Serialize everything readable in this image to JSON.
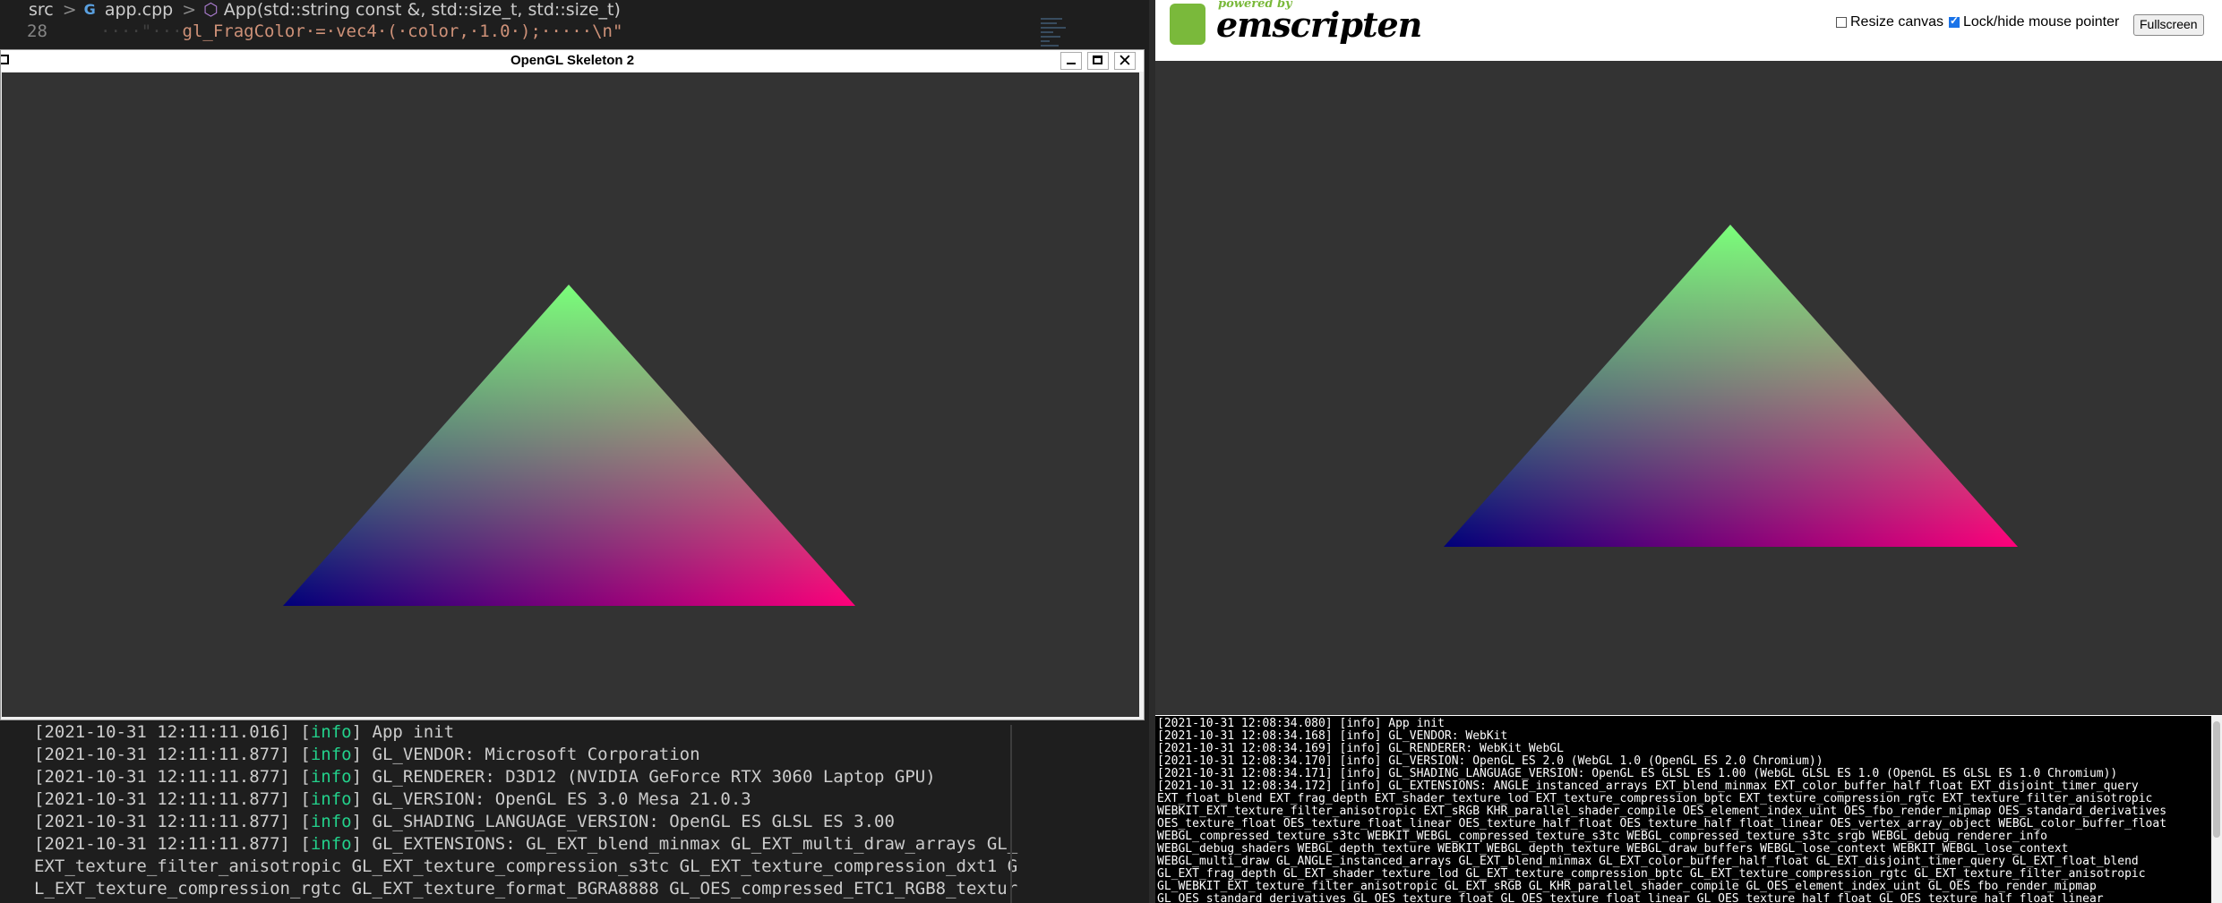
{
  "editor": {
    "breadcrumb": {
      "folder": "src",
      "file": "app.cpp",
      "symbol": "App(std::string const &, std::size_t, std::size_t)"
    },
    "line_number": "28",
    "code_ws_prefix": "····\"···",
    "code": "gl_FragColor·=·vec4·(·color,·1.0·);·····\\n\""
  },
  "terminal": {
    "lines": [
      {
        "prefix": "[2021-10-31 12:11:11.016] [",
        "level": "info",
        "text": "] App init"
      },
      {
        "prefix": "[2021-10-31 12:11:11.877] [",
        "level": "info",
        "text": "] GL_VENDOR: Microsoft Corporation"
      },
      {
        "prefix": "[2021-10-31 12:11:11.877] [",
        "level": "info",
        "text": "] GL_RENDERER: D3D12 (NVIDIA GeForce RTX 3060 Laptop GPU)"
      },
      {
        "prefix": "[2021-10-31 12:11:11.877] [",
        "level": "info",
        "text": "] GL_VERSION: OpenGL ES 3.0 Mesa 21.0.3"
      },
      {
        "prefix": "[2021-10-31 12:11:11.877] [",
        "level": "info",
        "text": "] GL_SHADING_LANGUAGE_VERSION: OpenGL ES GLSL ES 3.00"
      },
      {
        "prefix": "[2021-10-31 12:11:11.877] [",
        "level": "info",
        "text": "] GL_EXTENSIONS: GL_EXT_blend_minmax GL_EXT_multi_draw_arrays GL_"
      },
      {
        "prefix": "",
        "level": "",
        "text": "EXT_texture_filter_anisotropic GL_EXT_texture_compression_s3tc GL_EXT_texture_compression_dxt1 G"
      },
      {
        "prefix": "",
        "level": "",
        "text": "L_EXT_texture_compression_rgtc GL_EXT_texture_format_BGRA8888 GL_OES_compressed_ETC1_RGB8_textur"
      }
    ]
  },
  "gl_window": {
    "title": "OpenGL Skeleton 2",
    "close_glyph": "✕"
  },
  "emscripten": {
    "powered_by": "powered by",
    "logo_text": "emscripten",
    "resize_label": "Resize canvas",
    "resize_checked": false,
    "lock_label": "Lock/hide mouse pointer",
    "lock_checked": true,
    "fullscreen_label": "Fullscreen",
    "console_lines": [
      "[2021-10-31 12:08:34.080] [info] App init",
      "[2021-10-31 12:08:34.168] [info] GL_VENDOR: WebKit",
      "[2021-10-31 12:08:34.169] [info] GL_RENDERER: WebKit WebGL",
      "[2021-10-31 12:08:34.170] [info] GL_VERSION: OpenGL ES 2.0 (WebGL 1.0 (OpenGL ES 2.0 Chromium))",
      "[2021-10-31 12:08:34.171] [info] GL_SHADING_LANGUAGE_VERSION: OpenGL ES GLSL ES 1.00 (WebGL GLSL ES 1.0 (OpenGL ES GLSL ES 1.0 Chromium))",
      "[2021-10-31 12:08:34.172] [info] GL_EXTENSIONS: ANGLE_instanced_arrays EXT_blend_minmax EXT_color_buffer_half_float EXT_disjoint_timer_query",
      "EXT_float_blend EXT_frag_depth EXT_shader_texture_lod EXT_texture_compression_bptc EXT_texture_compression_rgtc EXT_texture_filter_anisotropic",
      "WEBKIT_EXT_texture_filter_anisotropic EXT_sRGB KHR_parallel_shader_compile OES_element_index_uint OES_fbo_render_mipmap OES_standard_derivatives",
      "OES_texture_float OES_texture_float_linear OES_texture_half_float OES_texture_half_float_linear OES_vertex_array_object WEBGL_color_buffer_float",
      "WEBGL_compressed_texture_s3tc WEBKIT_WEBGL_compressed_texture_s3tc WEBGL_compressed_texture_s3tc_srgb WEBGL_debug_renderer_info",
      "WEBGL_debug_shaders WEBGL_depth_texture WEBKIT_WEBGL_depth_texture WEBGL_draw_buffers WEBGL_lose_context WEBKIT_WEBGL_lose_context",
      "WEBGL_multi_draw GL_ANGLE_instanced_arrays GL_EXT_blend_minmax GL_EXT_color_buffer_half_float GL_EXT_disjoint_timer_query GL_EXT_float_blend",
      "GL_EXT_frag_depth GL_EXT_shader_texture_lod GL_EXT_texture_compression_bptc GL_EXT_texture_compression_rgtc GL_EXT_texture_filter_anisotropic",
      "GL_WEBKIT_EXT_texture_filter_anisotropic GL_EXT_sRGB GL_KHR_parallel_shader_compile GL_OES_element_index_uint GL_OES_fbo_render_mipmap",
      "GL_OES_standard_derivatives GL_OES_texture_float GL_OES_texture_float_linear GL_OES_texture_half_float GL_OES_texture_half_float_linear"
    ]
  },
  "colors": {
    "background_canvas": "#333333",
    "vertex_top": "#7aff7a",
    "vertex_left": "#00007a",
    "vertex_right": "#ff007a",
    "terminal_info": "#23d18b"
  }
}
